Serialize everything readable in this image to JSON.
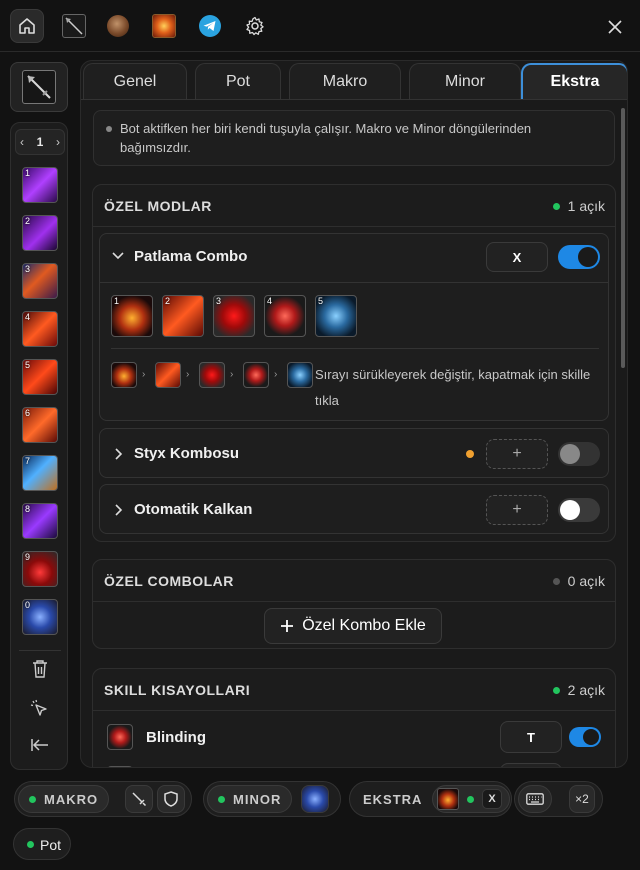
{
  "colors": {
    "accent": "#1e88e5",
    "active_tab_border": "#3d8fd9",
    "status_green": "#22c55e",
    "status_orange": "#f0a030",
    "status_grey": "#555555"
  },
  "topbar": {
    "icons": [
      "home-icon",
      "skill-thumb",
      "avatar",
      "fire-skill-thumb",
      "telegram-icon",
      "gear-icon"
    ],
    "close_icon": "close-icon"
  },
  "sidebar": {
    "page": "1",
    "slots": [
      {
        "num": "1"
      },
      {
        "num": "2"
      },
      {
        "num": "3"
      },
      {
        "num": "4"
      },
      {
        "num": "5"
      },
      {
        "num": "6"
      },
      {
        "num": "7"
      },
      {
        "num": "8"
      },
      {
        "num": "9"
      },
      {
        "num": "0"
      }
    ],
    "footer_icons": [
      "trash-icon",
      "cursor-icon",
      "collapse-icon"
    ]
  },
  "tabs": [
    {
      "label": "Genel"
    },
    {
      "label": "Pot"
    },
    {
      "label": "Makro"
    },
    {
      "label": "Minor"
    },
    {
      "label": "Ekstra",
      "active": true
    }
  ],
  "info": "Bot aktifken her biri kendi tuşuyla çalışır. Makro ve Minor döngülerinden bağımsızdır.",
  "special_modes": {
    "title": "ÖZEL MODLAR",
    "count": "1 açık",
    "patlama": {
      "title": "Patlama Combo",
      "key": "X",
      "enabled": true,
      "skills": [
        {
          "num": "1"
        },
        {
          "num": "2"
        },
        {
          "num": "3"
        },
        {
          "num": "4"
        },
        {
          "num": "5"
        }
      ],
      "hint": "Sırayı sürükleyerek değiştir, kapatmak için skille tıkla"
    },
    "styx": {
      "title": "Styx Kombosu",
      "key": "+",
      "enabled": false
    },
    "kalkan": {
      "title": "Otomatik Kalkan",
      "key": "+",
      "enabled": false
    }
  },
  "custom_combos": {
    "title": "ÖZEL COMBOLAR",
    "count": "0 açık",
    "add_label": "Özel Kombo Ekle"
  },
  "skill_shortcuts": {
    "title": "SKILL KISAYOLLARI",
    "count": "2 açık",
    "rows": [
      {
        "name": "Blinding",
        "key": "T",
        "enabled": true
      }
    ]
  },
  "bottom": {
    "makro": "MAKRO",
    "minor": "MINOR",
    "ekstra": "EKSTRA",
    "ekstra_key": "X",
    "multiplier": "×2",
    "pot": "Pot"
  }
}
